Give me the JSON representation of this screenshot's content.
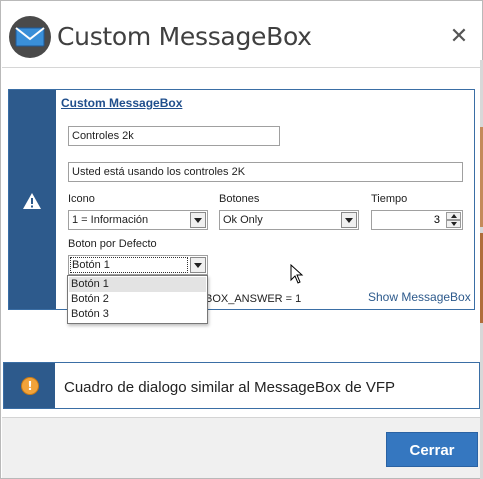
{
  "window": {
    "title": "Custom MessageBox",
    "close_glyph": "✕"
  },
  "panel": {
    "title": "Custom MessageBox",
    "caption_value": "Controles 2k",
    "message_value": "Usted está usando los controles 2K",
    "icono": {
      "label": "Icono",
      "selected": "1 = Información"
    },
    "botones": {
      "label": "Botones",
      "selected": "Ok Only"
    },
    "tiempo": {
      "label": "Tiempo",
      "value": "3"
    },
    "boton_defecto": {
      "label": "Boton por Defecto",
      "selected": "Botón 1"
    },
    "result_text": "BOX_ANSWER = 1",
    "show_link": "Show MessageBox"
  },
  "dropdown": {
    "options": [
      "Botón 1",
      "Botón 2",
      "Botón 3"
    ],
    "highlighted_index": 0
  },
  "message_strip": {
    "text": "Cuadro de dialogo similar al MessageBox de VFP"
  },
  "footer": {
    "close_button": "Cerrar"
  },
  "colors": {
    "accent": "#2d5a8c",
    "button": "#3577c0",
    "info_icon": "#f2a33a"
  },
  "icons": {
    "app": "envelope-icon",
    "panel": "warning-icon",
    "message": "exclamation-icon"
  }
}
